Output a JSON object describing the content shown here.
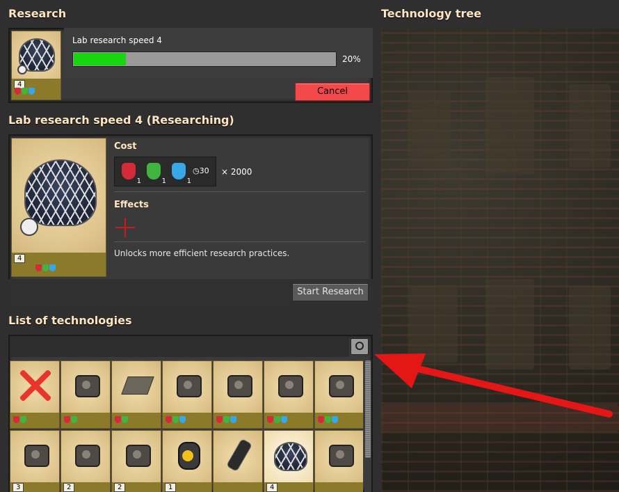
{
  "research": {
    "title": "Research",
    "current_name": "Lab research speed 4",
    "progress_pct": 20,
    "progress_label": "20%",
    "level": "4",
    "cancel_label": "Cancel"
  },
  "detail": {
    "title": "Lab research speed 4 (Researching)",
    "level": "4",
    "cost_label": "Cost",
    "ingredients": [
      {
        "color": "#d42a3a",
        "count": "1"
      },
      {
        "color": "#3fb43f",
        "count": "1"
      },
      {
        "color": "#37a7e8",
        "count": "1"
      }
    ],
    "time": "30",
    "multiplier": "× 2000",
    "effects_label": "Effects",
    "description": "Unlocks more efficient research practices.",
    "start_label": "Start Research"
  },
  "list": {
    "title": "List of technologies",
    "search_placeholder": "",
    "row1": [
      {
        "icon": "locked-technology-icon",
        "flasks": [
          "red",
          "green"
        ]
      },
      {
        "icon": "mechanical-parts-icon",
        "flasks": [
          "red",
          "green"
        ]
      },
      {
        "icon": "concrete-tile-icon",
        "flasks": [
          "red",
          "green"
        ]
      },
      {
        "icon": "gun-turret-icon",
        "flasks": [
          "red",
          "green",
          "blue"
        ]
      },
      {
        "icon": "landmine-icon",
        "flasks": [
          "red",
          "green",
          "blue"
        ]
      },
      {
        "icon": "robot-drone-icon",
        "flasks": [
          "red",
          "green",
          "blue"
        ]
      },
      {
        "icon": "rocket-icon",
        "flasks": [
          "red",
          "green",
          "blue"
        ]
      }
    ],
    "row2": [
      {
        "icon": "battery-equipment-icon",
        "level": "3"
      },
      {
        "icon": "character-speed-icon",
        "level": "2"
      },
      {
        "icon": "character-mining-icon",
        "level": "2"
      },
      {
        "icon": "health-upgrade-icon",
        "level": "1"
      },
      {
        "icon": "fuel-cell-icon",
        "level": ""
      },
      {
        "icon": "lab-dome-icon",
        "level": "4"
      },
      {
        "icon": "vehicle-icon",
        "level": ""
      }
    ]
  },
  "tree": {
    "title": "Technology tree"
  },
  "colors": {
    "progress_fill": "#19d410",
    "cancel_red": "#f4494b",
    "annotation_arrow": "#e51616"
  }
}
